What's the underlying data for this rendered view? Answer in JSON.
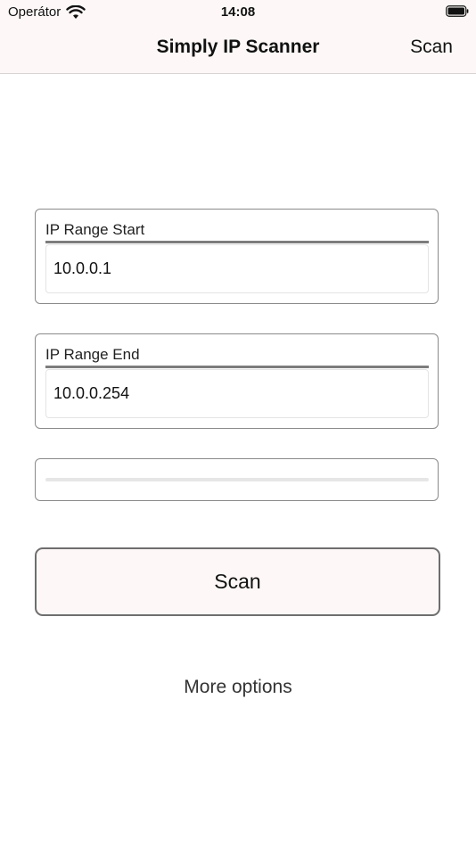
{
  "status_bar": {
    "carrier": "Operátor",
    "time": "14:08",
    "wifi_icon": "wifi-icon",
    "battery_icon": "battery-icon",
    "battery_level": 1.0
  },
  "nav": {
    "title": "Simply IP Scanner",
    "scan_label": "Scan"
  },
  "range_start": {
    "label": "IP Range Start",
    "value": "10.0.0.1"
  },
  "range_end": {
    "label": "IP Range End",
    "value": "10.0.0.254"
  },
  "progress": {
    "value": 0
  },
  "scan_button": {
    "label": "Scan"
  },
  "more_options": {
    "label": "More options"
  },
  "colors": {
    "bar_background": "#fdf8f7",
    "border": "#8a8a8a",
    "button_border": "#6e6e6e"
  }
}
